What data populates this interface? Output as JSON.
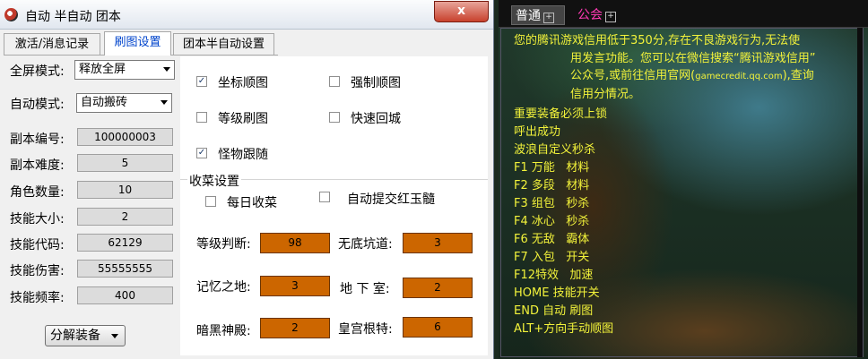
{
  "window": {
    "title": "自动 半自动 团本",
    "close_symbol": "x"
  },
  "tabs": [
    {
      "label": "激活/消息记录",
      "active": false
    },
    {
      "label": "刷图设置",
      "active": true
    },
    {
      "label": "团本半自动设置",
      "active": false
    }
  ],
  "left_form": {
    "fullscreen_mode_label": "全屏模式:",
    "fullscreen_mode_value": "释放全屏",
    "auto_mode_label": "自动模式:",
    "auto_mode_value": "自动搬砖",
    "fields": [
      {
        "label": "副本编号:",
        "value": "100000003"
      },
      {
        "label": "副本难度:",
        "value": "5"
      },
      {
        "label": "角色数量:",
        "value": "10"
      },
      {
        "label": "技能大小:",
        "value": "2"
      },
      {
        "label": "技能代码:",
        "value": "62129"
      },
      {
        "label": "技能伤害:",
        "value": "55555555"
      },
      {
        "label": "技能频率:",
        "value": "400"
      }
    ],
    "decompose_button": "分解装备"
  },
  "options": {
    "coord_route": {
      "label": "坐标顺图",
      "checked": true
    },
    "force_route": {
      "label": "强制顺图",
      "checked": false
    },
    "level_grind": {
      "label": "等级刷图",
      "checked": false
    },
    "quick_return": {
      "label": "快速回城",
      "checked": false
    },
    "follow_monster": {
      "label": "怪物跟随",
      "checked": true
    }
  },
  "harvest": {
    "group_title": "收菜设置",
    "daily_harvest": {
      "label": "每日收菜",
      "checked": false
    },
    "auto_submit": {
      "label": "自动提交红玉髓",
      "checked": false
    },
    "fields": {
      "level_judge": {
        "label": "等级判断:",
        "value": "98"
      },
      "bottomless": {
        "label": "无底坑道:",
        "value": "3"
      },
      "memory_land": {
        "label": "记忆之地:",
        "value": "3"
      },
      "basement": {
        "label": "地 下 室:",
        "value": "2"
      },
      "dark_temple": {
        "label": "暗黑神殿:",
        "value": "2"
      },
      "palace_gente": {
        "label": "皇宫根特:",
        "value": "6"
      }
    }
  },
  "game_chat": {
    "tab_normal": "普通",
    "tab_guild": "公会",
    "tab_plus": "+",
    "notice_line1": "您的腾讯游戏信用低于350分,存在不良游戏行为,无法使",
    "notice_line2": "用发言功能。您可以在微信搜索“腾讯游戏信用”",
    "notice_line3a": "公众号,或前往信用官网(",
    "notice_url": "gamecredit.qq.com",
    "notice_line3b": "),查询",
    "notice_line4": "信用分情况。",
    "lines": [
      "重要装备必须上锁",
      "呼出成功",
      "波浪自定义秒杀",
      "F1 万能   材料",
      "F2 多段   材料",
      "F3 组包   秒杀",
      "F4 冰心   秒杀",
      "F6 无敌   霸体",
      "F7 入包   开关",
      "F12特效   加速",
      "HOME 技能开关",
      "END 自动 刷图",
      "ALT+方向手动顺图"
    ],
    "colors": {
      "chat_text": "#f2f23a",
      "guild_tab": "#ff3ab4"
    }
  },
  "colors": {
    "orange_field": "#cc6600",
    "close_button": "#c8412d",
    "active_tab_text": "#0044cc"
  }
}
